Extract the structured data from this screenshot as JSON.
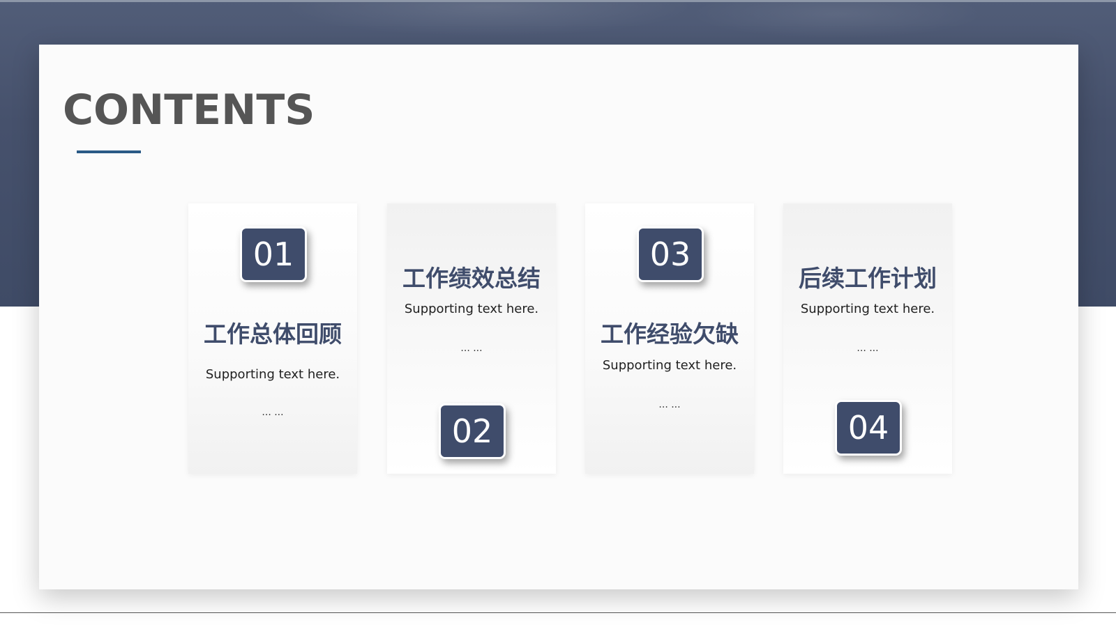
{
  "slide": {
    "title": "CONTENTS",
    "sections": [
      {
        "number": "01",
        "title": "工作总体回顾",
        "text": "Supporting text here.",
        "ellipsis": "... ..."
      },
      {
        "number": "02",
        "title": "工作绩效总结",
        "text": "Supporting text here.",
        "ellipsis": "... ..."
      },
      {
        "number": "03",
        "title": "工作经验欠缺",
        "text": "Supporting text here.",
        "ellipsis": "... ..."
      },
      {
        "number": "04",
        "title": "后续工作计划",
        "text": "Supporting text here.",
        "ellipsis": "... ..."
      }
    ]
  },
  "colors": {
    "accent": "#3f4c6b",
    "underline": "#2a5a86",
    "title_text": "#555555"
  }
}
